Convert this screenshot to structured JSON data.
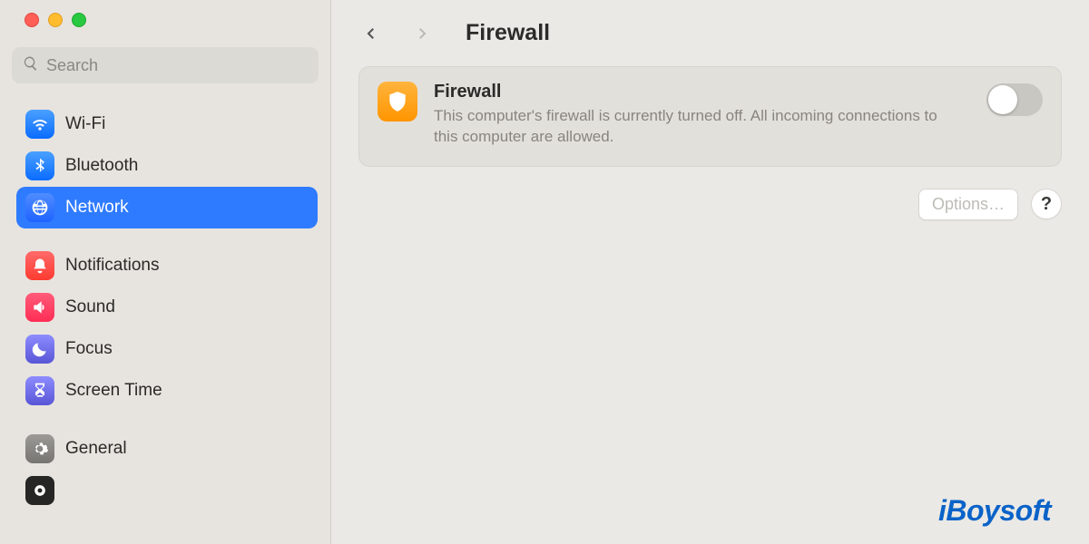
{
  "window": {
    "title": "Firewall"
  },
  "search": {
    "placeholder": "Search"
  },
  "sidebar": {
    "group1": [
      {
        "label": "Wi-Fi",
        "icon": "wifi-icon",
        "selected": false
      },
      {
        "label": "Bluetooth",
        "icon": "bluetooth-icon",
        "selected": false
      },
      {
        "label": "Network",
        "icon": "globe-icon",
        "selected": true
      }
    ],
    "group2": [
      {
        "label": "Notifications",
        "icon": "bell-icon"
      },
      {
        "label": "Sound",
        "icon": "speaker-icon"
      },
      {
        "label": "Focus",
        "icon": "moon-icon"
      },
      {
        "label": "Screen Time",
        "icon": "hourglass-icon"
      }
    ],
    "group3": [
      {
        "label": "General",
        "icon": "gear-icon"
      }
    ]
  },
  "firewall": {
    "title": "Firewall",
    "description": "This computer's firewall is currently turned off. All incoming connections to this computer are allowed.",
    "enabled": false
  },
  "actions": {
    "options_label": "Options…",
    "help_label": "?"
  },
  "watermark": "iBoysoft"
}
